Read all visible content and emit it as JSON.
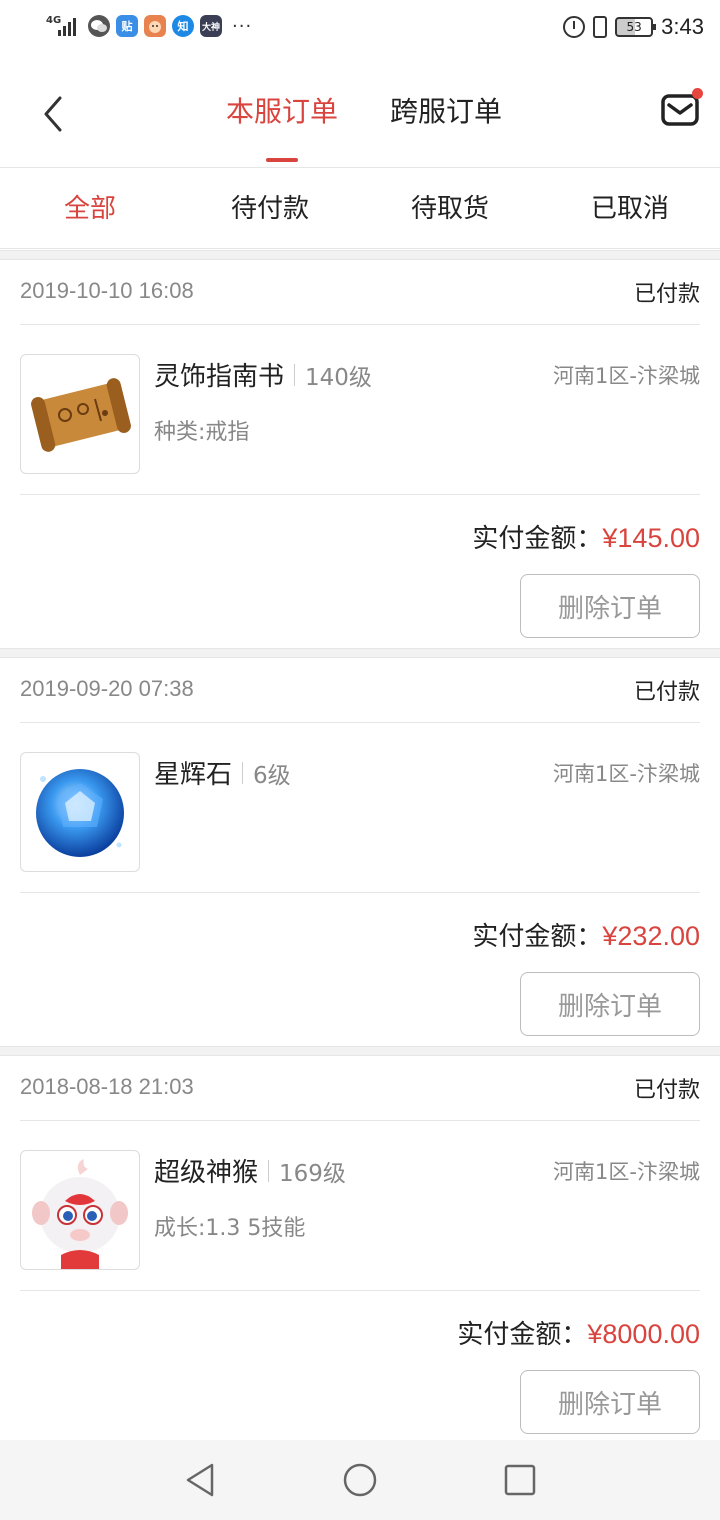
{
  "status_bar": {
    "network": "4G",
    "app_icons": [
      "wechat-icon",
      "tieba-icon",
      "game-icon",
      "zhihu-icon",
      "dashen-icon"
    ],
    "app_labels": {
      "tieba": "贴",
      "zhihu": "知",
      "dashen": "大神"
    },
    "more": "···",
    "battery": "53",
    "time": "3:43"
  },
  "header": {
    "tabs": [
      {
        "label": "本服订单",
        "active": true
      },
      {
        "label": "跨服订单",
        "active": false
      }
    ],
    "has_unread_mail": true
  },
  "filters": [
    {
      "label": "全部",
      "active": true
    },
    {
      "label": "待付款",
      "active": false
    },
    {
      "label": "待取货",
      "active": false
    },
    {
      "label": "已取消",
      "active": false
    }
  ],
  "colors": {
    "accent": "#d9443e",
    "muted": "#888888",
    "divider": "#e6e6e6"
  },
  "orders": [
    {
      "date": "2019-10-10 16:08",
      "status": "已付款",
      "name": "灵饰指南书",
      "level": "140级",
      "server": "河南1区-汴梁城",
      "attr": "种类:戒指",
      "pay_label": "实付金额：",
      "price": "¥145.00",
      "delete_label": "删除订单",
      "thumb_icon": "scroll-icon"
    },
    {
      "date": "2019-09-20 07:38",
      "status": "已付款",
      "name": "星辉石",
      "level": "6级",
      "server": "河南1区-汴梁城",
      "attr": "",
      "pay_label": "实付金额：",
      "price": "¥232.00",
      "delete_label": "删除订单",
      "thumb_icon": "blue-gem-icon"
    },
    {
      "date": "2018-08-18 21:03",
      "status": "已付款",
      "name": "超级神猴",
      "level": "169级",
      "server": "河南1区-汴梁城",
      "attr": "成长:1.3 5技能",
      "pay_label": "实付金额：",
      "price": "¥8000.00",
      "delete_label": "删除订单",
      "thumb_icon": "monkey-pet-icon"
    }
  ],
  "nav": [
    "back-nav-icon",
    "home-nav-icon",
    "recents-nav-icon"
  ]
}
